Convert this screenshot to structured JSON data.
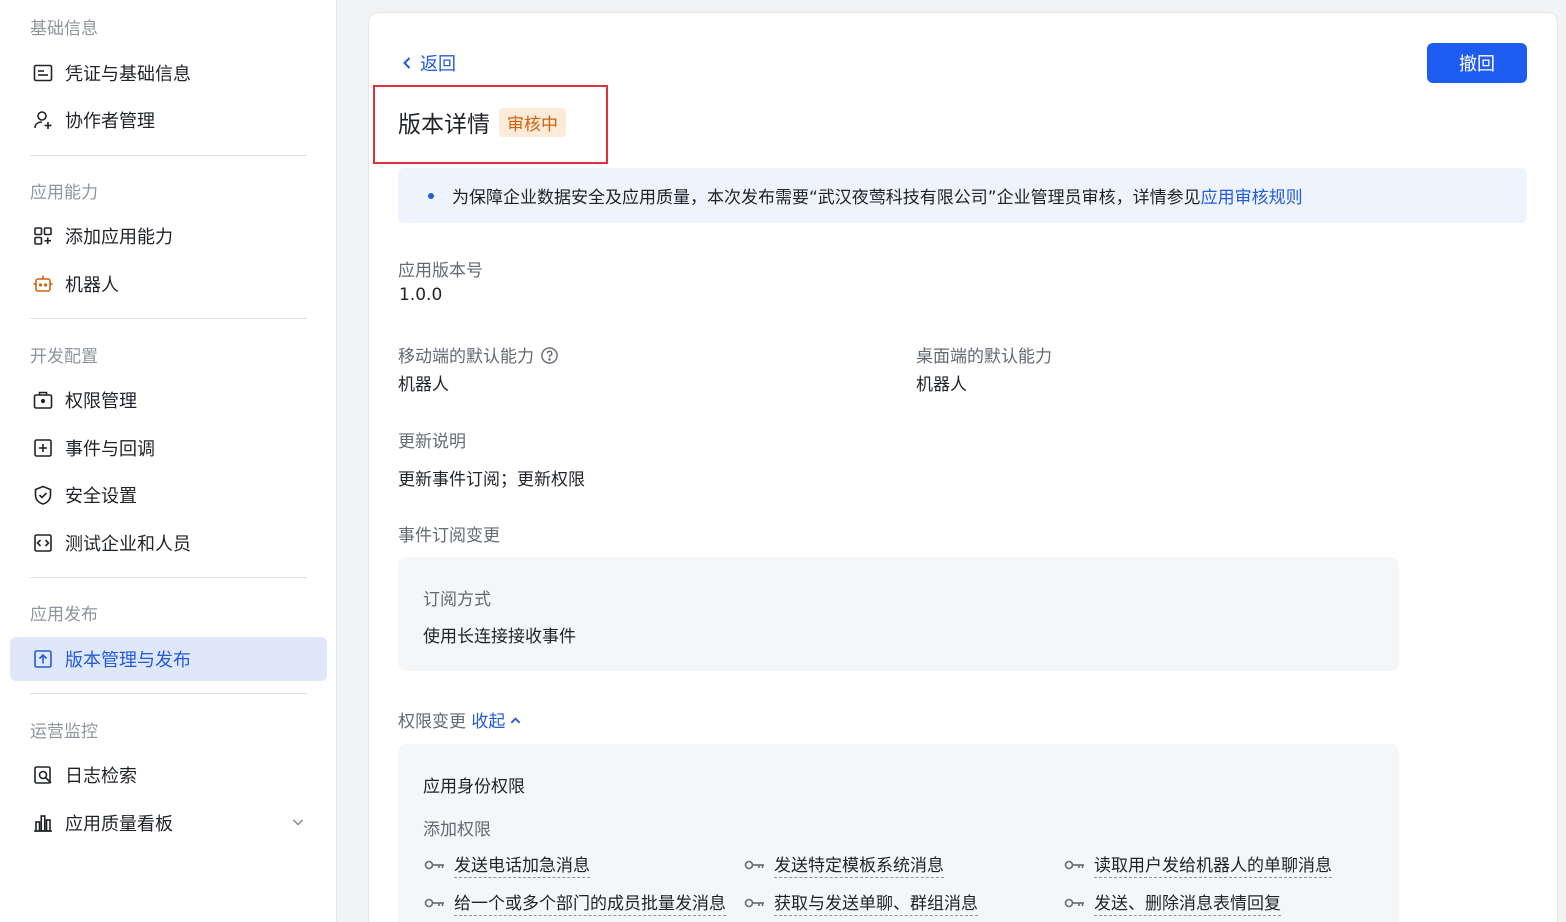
{
  "sidebar": {
    "groups": [
      {
        "title": "基础信息",
        "items": [
          {
            "label": "凭证与基础信息",
            "icon": "credential-icon"
          },
          {
            "label": "协作者管理",
            "icon": "add-user-icon"
          }
        ]
      },
      {
        "title": "应用能力",
        "items": [
          {
            "label": "添加应用能力",
            "icon": "apps-grid-icon"
          },
          {
            "label": "机器人",
            "icon": "robot-icon"
          }
        ]
      },
      {
        "title": "开发配置",
        "items": [
          {
            "label": "权限管理",
            "icon": "briefcase-lock-icon"
          },
          {
            "label": "事件与回调",
            "icon": "event-plus-icon"
          },
          {
            "label": "安全设置",
            "icon": "shield-check-icon"
          },
          {
            "label": "测试企业和人员",
            "icon": "code-box-icon"
          }
        ]
      },
      {
        "title": "应用发布",
        "items": [
          {
            "label": "版本管理与发布",
            "icon": "upload-box-icon",
            "active": true
          }
        ]
      },
      {
        "title": "运营监控",
        "items": [
          {
            "label": "日志检索",
            "icon": "log-search-icon"
          },
          {
            "label": "应用质量看板",
            "icon": "bar-chart-icon"
          }
        ]
      }
    ]
  },
  "header": {
    "back_label": "返回",
    "withdraw_label": "撤回",
    "title": "版本详情",
    "status": "审核中"
  },
  "notice": {
    "text": "为保障企业数据安全及应用质量，本次发布需要“武汉夜莺科技有限公司”企业管理员审核，详情参见",
    "link": "应用审核规则"
  },
  "details": {
    "version_label": "应用版本号",
    "version_value": "1.0.0",
    "mobile_label": "移动端的默认能力",
    "mobile_value": "机器人",
    "desktop_label": "桌面端的默认能力",
    "desktop_value": "机器人",
    "update_label": "更新说明",
    "update_value": "更新事件订阅；更新权限",
    "event_change_label": "事件订阅变更",
    "subscribe_mode_label": "订阅方式",
    "subscribe_mode_value": "使用长连接接收事件",
    "perm_change_label": "权限变更",
    "collapse_label": "收起",
    "app_identity_label": "应用身份权限",
    "add_perm_label": "添加权限"
  },
  "permissions": [
    "发送电话加急消息",
    "发送特定模板系统消息",
    "读取用户发给机器人的单聊消息",
    "给一个或多个部门的成员批量发消息",
    "获取与发送单聊、群组消息",
    "发送、删除消息表情回复"
  ],
  "colors": {
    "accent": "#245bdb",
    "primary_button": "#1e5cf1",
    "status_bg": "#fdebd9",
    "status_text": "#d0620f",
    "highlight_border": "#e0303c"
  }
}
